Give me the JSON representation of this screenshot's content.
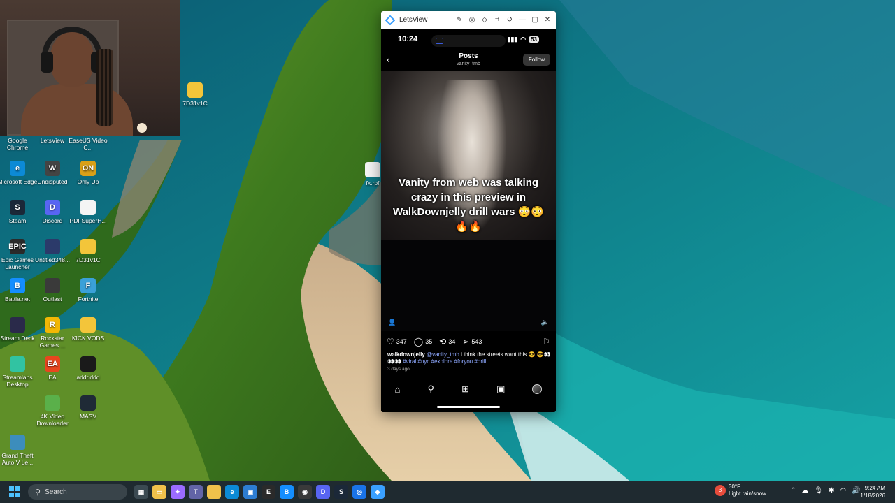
{
  "webcam": {
    "description_label": ""
  },
  "desktop_icons": [
    {
      "label": "Google Chrome",
      "glyph": "",
      "color": "#1a73e8",
      "col": 0,
      "row": 0
    },
    {
      "label": "LetsView",
      "glyph": "",
      "color": "#3aa0ff",
      "col": 1,
      "row": 0
    },
    {
      "label": "EaseUS Video C...",
      "glyph": "",
      "color": "#2c7be5",
      "col": 2,
      "row": 0
    },
    {
      "label": "Microsoft Edge",
      "glyph": "e",
      "color": "#0c8ad6",
      "col": 0,
      "row": 1
    },
    {
      "label": "Undisputed",
      "glyph": "W",
      "color": "#444444",
      "col": 1,
      "row": 1
    },
    {
      "label": "Only Up",
      "glyph": "ON",
      "color": "#d9a018",
      "col": 2,
      "row": 1
    },
    {
      "label": "Steam",
      "glyph": "S",
      "color": "#1b2838",
      "col": 0,
      "row": 2
    },
    {
      "label": "Discord",
      "glyph": "D",
      "color": "#5865f2",
      "col": 1,
      "row": 2
    },
    {
      "label": "PDFSuperH...",
      "glyph": "",
      "color": "#f4f4f4",
      "col": 2,
      "row": 2
    },
    {
      "label": "Epic Games Launcher",
      "glyph": "EPIC",
      "color": "#2a2a2a",
      "col": 0,
      "row": 3
    },
    {
      "label": "Untitled348...",
      "glyph": "",
      "color": "#2b3a6a",
      "col": 1,
      "row": 3
    },
    {
      "label": "7D31v1C",
      "glyph": "",
      "color": "#f3c53a",
      "col": 2,
      "row": 3
    },
    {
      "label": "Battle.net",
      "glyph": "B",
      "color": "#148eff",
      "col": 0,
      "row": 4
    },
    {
      "label": "Outlast",
      "glyph": "",
      "color": "#3a3a3a",
      "col": 1,
      "row": 4
    },
    {
      "label": "Fortnite",
      "glyph": "F",
      "color": "#3aa0d8",
      "col": 2,
      "row": 4
    },
    {
      "label": "Stream Deck",
      "glyph": "",
      "color": "#2a2a4a",
      "col": 0,
      "row": 5
    },
    {
      "label": "Rockstar Games ...",
      "glyph": "R",
      "color": "#f2b705",
      "col": 1,
      "row": 5
    },
    {
      "label": "KICK VODS",
      "glyph": "",
      "color": "#f3c53a",
      "col": 2,
      "row": 5
    },
    {
      "label": "Streamlabs Desktop",
      "glyph": "",
      "color": "#31c3a2",
      "col": 0,
      "row": 6
    },
    {
      "label": "EA",
      "glyph": "EA",
      "color": "#e8461e",
      "col": 1,
      "row": 6
    },
    {
      "label": "adddddd",
      "glyph": "",
      "color": "#1a1a1a",
      "col": 2,
      "row": 6
    },
    {
      "label": "4K Video Downloader",
      "glyph": "",
      "color": "#5ab04a",
      "col": 1,
      "row": 7
    },
    {
      "label": "MASV",
      "glyph": "",
      "color": "#1f2a36",
      "col": 2,
      "row": 7
    },
    {
      "label": "Grand Theft Auto V Le...",
      "glyph": "",
      "color": "#3c8dbc",
      "col": 0,
      "row": 8
    }
  ],
  "desktop_extra": [
    {
      "label": "7D31v1C",
      "color": "#f3c53a"
    },
    {
      "label": "fx.rpf",
      "color": "#f4f4f4"
    }
  ],
  "letsview": {
    "title": "LetsView",
    "phone": {
      "time": "10:24",
      "battery": "53",
      "posts_heading": "Posts",
      "posts_username": "vanity_tmb",
      "follow_label": "Follow",
      "caption": "Vanity from web was talking crazy in this preview in WalkDownjelly drill wars 😳😳 🔥🔥",
      "likes": "347",
      "comments": "35",
      "reposts": "34",
      "shares": "543",
      "desc_handle": "walkdownjelly",
      "desc_mention": "@vanity_tmb",
      "desc_text": "i think the streets want this 😎 😎👀👀👀",
      "desc_tags": "#viral #nyc #explore #foryou #drill",
      "time_ago": "3 days ago"
    }
  },
  "taskbar": {
    "search_placeholder": "Search",
    "weather_temp": "30°F",
    "weather_desc": "Light rain/snow",
    "weather_badge": "3",
    "clock_time": "9:24 AM",
    "clock_date": "1/18/2026",
    "apps": [
      {
        "name": "widgets-icon",
        "glyph": "▦",
        "color": "#3b4a52"
      },
      {
        "name": "file-explorer-icon",
        "glyph": "▭",
        "color": "#f0c14b"
      },
      {
        "name": "copilot-icon",
        "glyph": "✦",
        "color": "#9b6bff"
      },
      {
        "name": "teams-icon",
        "glyph": "T",
        "color": "#6264a7"
      },
      {
        "name": "folder-icon",
        "glyph": "",
        "color": "#f0c14b"
      },
      {
        "name": "edge-icon",
        "glyph": "e",
        "color": "#0c8ad6"
      },
      {
        "name": "store-icon",
        "glyph": "▣",
        "color": "#2d7dd2"
      },
      {
        "name": "epic-icon",
        "glyph": "E",
        "color": "#2a2a2a"
      },
      {
        "name": "battlenet-icon",
        "glyph": "B",
        "color": "#148eff"
      },
      {
        "name": "obs-icon",
        "glyph": "◉",
        "color": "#3a3a3a"
      },
      {
        "name": "discord-icon",
        "glyph": "D",
        "color": "#5865f2"
      },
      {
        "name": "steam-icon",
        "glyph": "S",
        "color": "#1b2838"
      },
      {
        "name": "chrome-icon",
        "glyph": "◎",
        "color": "#1a73e8"
      },
      {
        "name": "letsview-icon",
        "glyph": "◆",
        "color": "#3aa0ff"
      }
    ]
  }
}
